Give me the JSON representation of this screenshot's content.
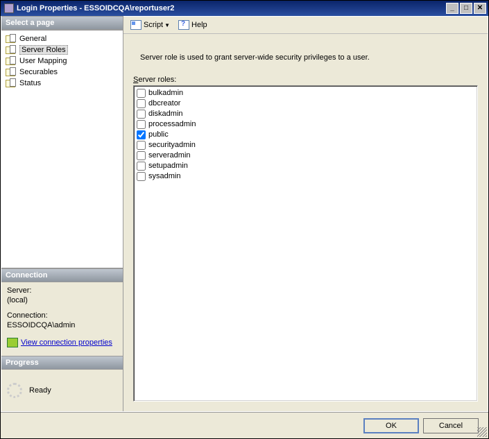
{
  "window": {
    "title": "Login Properties - ESSOIDCQA\\reportuser2"
  },
  "sidebar": {
    "select_header": "Select a page",
    "items": [
      {
        "label": "General"
      },
      {
        "label": "Server Roles"
      },
      {
        "label": "User Mapping"
      },
      {
        "label": "Securables"
      },
      {
        "label": "Status"
      }
    ],
    "selected_index": 1,
    "connection_header": "Connection",
    "server_label": "Server:",
    "server_value": "(local)",
    "connection_label": "Connection:",
    "connection_value": "ESSOIDCQA\\admin",
    "view_props": "View connection properties",
    "progress_header": "Progress",
    "progress_status": "Ready"
  },
  "toolbar": {
    "script_label": "Script",
    "help_label": "Help"
  },
  "main": {
    "description": "Server role is used to grant server-wide security privileges to a user.",
    "roles_label_accel": "S",
    "roles_label_rest": "erver roles:",
    "roles": [
      {
        "name": "bulkadmin",
        "checked": false
      },
      {
        "name": "dbcreator",
        "checked": false
      },
      {
        "name": "diskadmin",
        "checked": false
      },
      {
        "name": "processadmin",
        "checked": false
      },
      {
        "name": "public",
        "checked": true
      },
      {
        "name": "securityadmin",
        "checked": false
      },
      {
        "name": "serveradmin",
        "checked": false
      },
      {
        "name": "setupadmin",
        "checked": false
      },
      {
        "name": "sysadmin",
        "checked": false
      }
    ]
  },
  "footer": {
    "ok": "OK",
    "cancel": "Cancel"
  }
}
